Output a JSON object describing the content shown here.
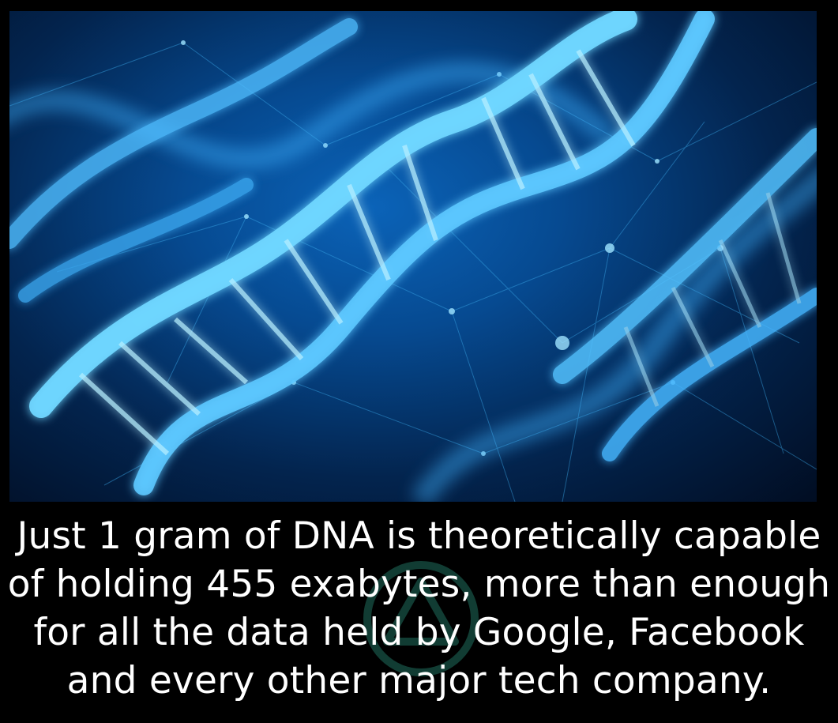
{
  "caption": {
    "lines": [
      "Just 1 gram of DNA is theoretically capable",
      "of holding 455 exabytes, more than enough",
      "for all the data held by Google, Facebook",
      "and every other major tech company."
    ]
  },
  "photo": {
    "subject": "dna-double-helix",
    "colors": {
      "background_dark": "#010d22",
      "helix_glow": "#6fd6ff",
      "helix_core": "#2aa3f0",
      "network_lines": "#3aa8e8"
    }
  },
  "watermark": {
    "icon": "triangle-arrows-logo-icon",
    "color": "#1f6e5e"
  }
}
